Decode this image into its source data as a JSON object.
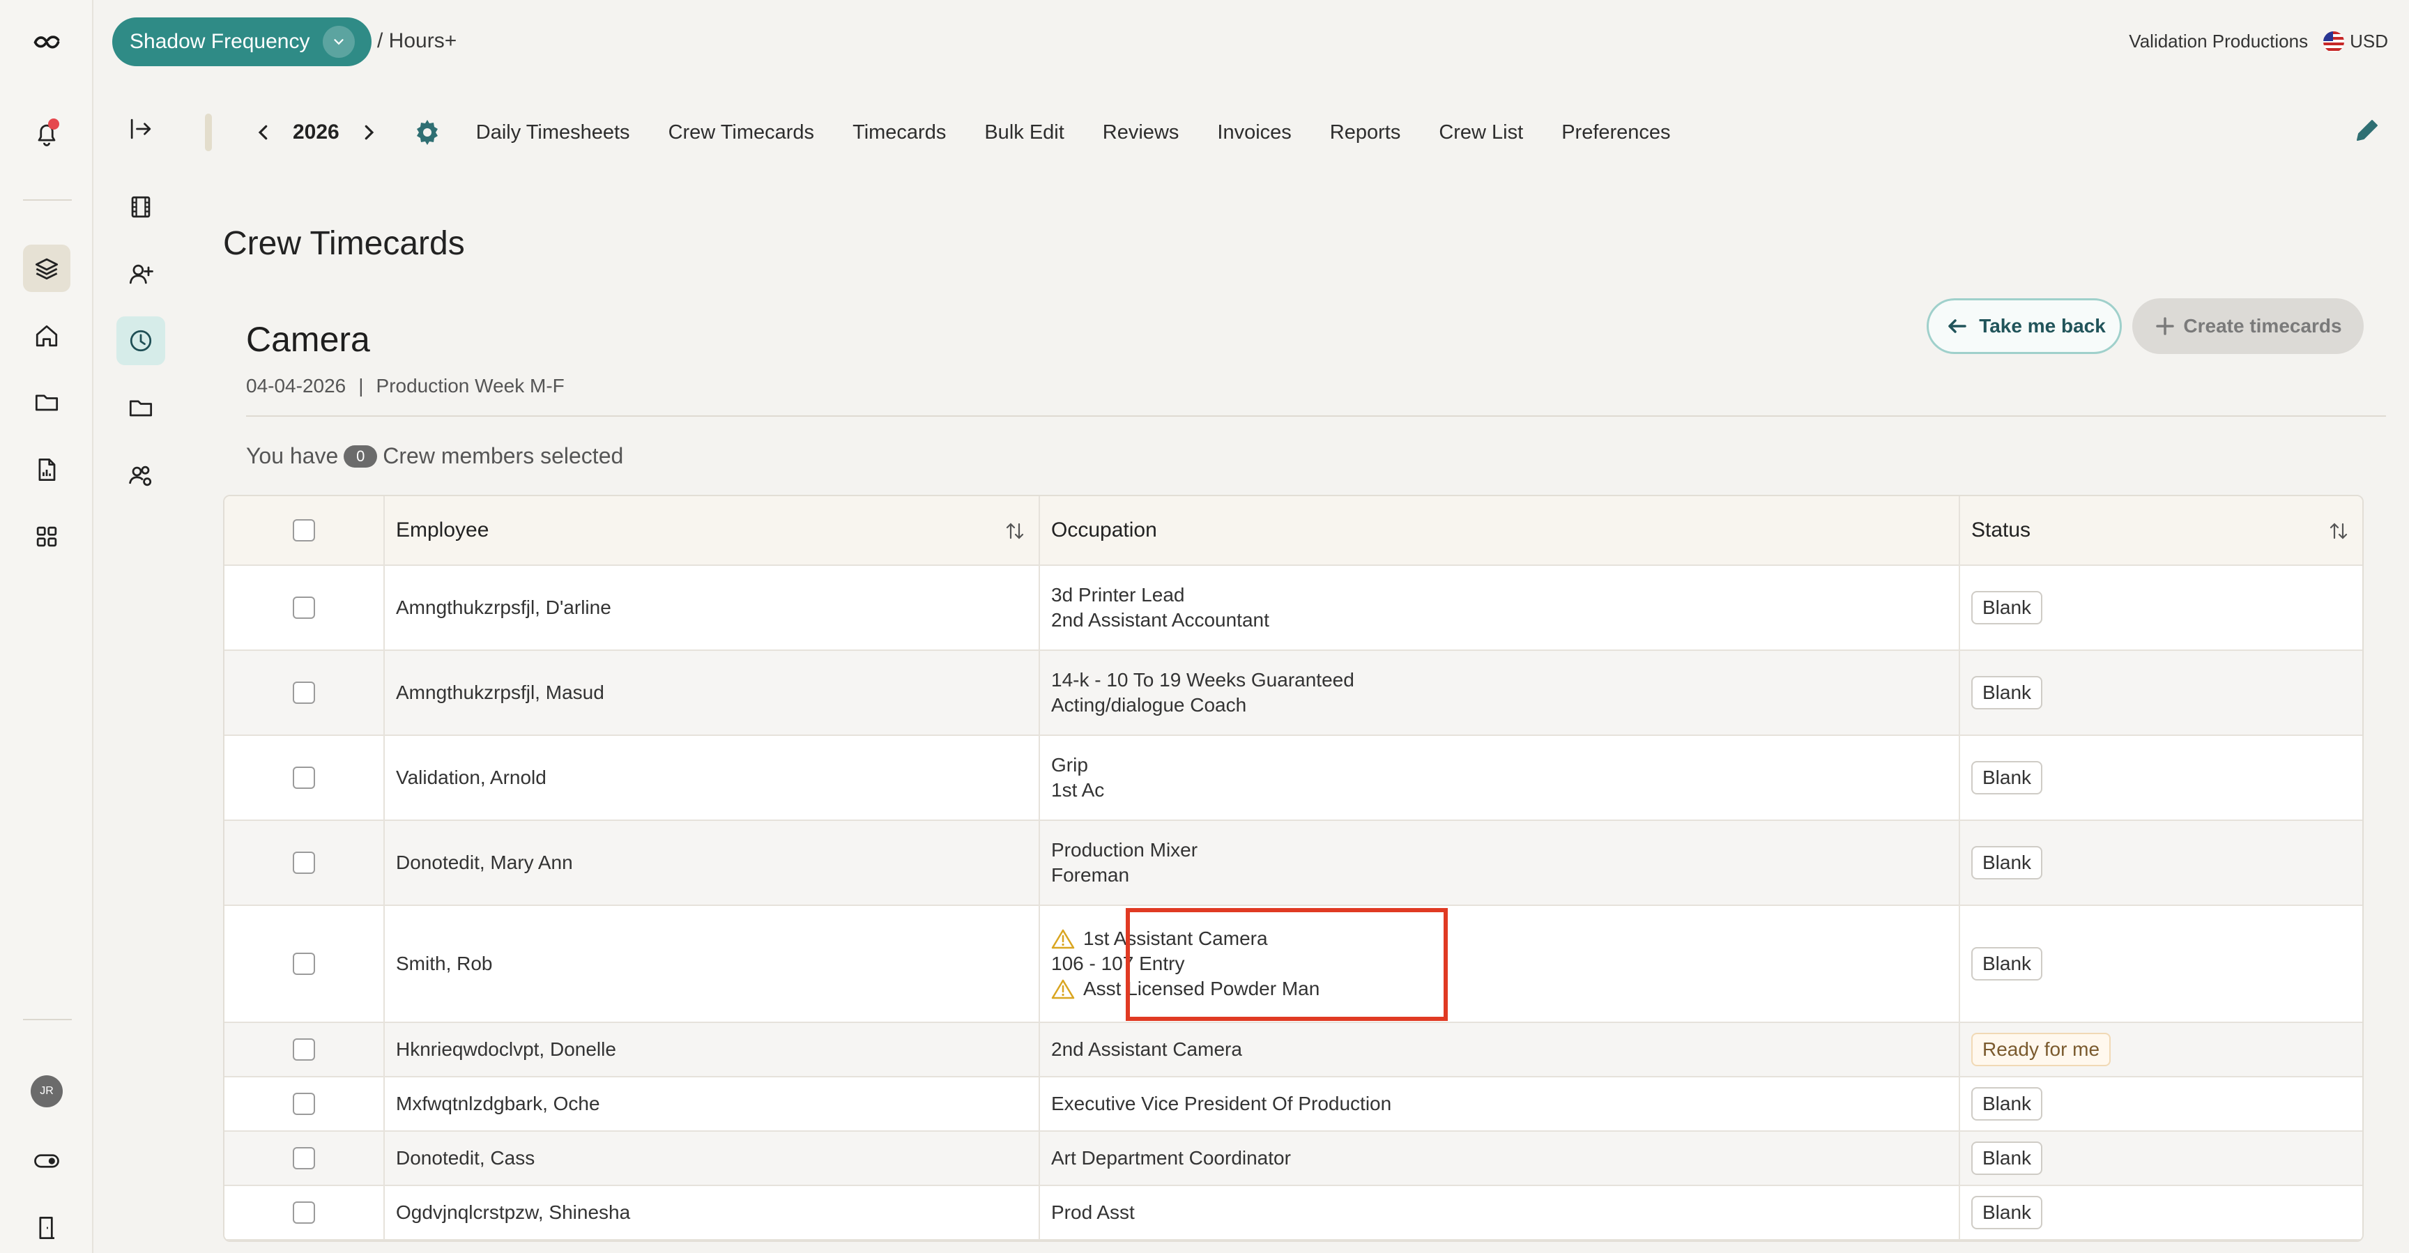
{
  "topbar": {
    "project_name": "Shadow Frequency",
    "breadcrumb": "/ Hours+",
    "company": "Validation Productions",
    "currency": "USD"
  },
  "nav": {
    "year": "2026",
    "items": [
      "Daily Timesheets",
      "Crew Timecards",
      "Timecards",
      "Bulk Edit",
      "Reviews",
      "Invoices",
      "Reports",
      "Crew List",
      "Preferences"
    ]
  },
  "user": {
    "initials": "JR"
  },
  "page": {
    "title": "Crew Timecards",
    "section": "Camera",
    "date": "04-04-2026",
    "week": "Production Week M-F",
    "back_label": "Take me back",
    "create_label": "Create timecards",
    "selected_prefix": "You have",
    "selected_count": "0",
    "selected_suffix": "Crew members selected"
  },
  "table": {
    "headers": {
      "employee": "Employee",
      "occupation": "Occupation",
      "status": "Status"
    },
    "rows": [
      {
        "employee": "Amngthukzrpsfjl, D'arline",
        "occupations": [
          "3d Printer Lead",
          "2nd Assistant Accountant"
        ],
        "status": "Blank"
      },
      {
        "employee": "Amngthukzrpsfjl, Masud",
        "occupations": [
          "14-k - 10 To 19 Weeks Guaranteed",
          "Acting/dialogue Coach"
        ],
        "status": "Blank"
      },
      {
        "employee": "Validation, Arnold",
        "occupations": [
          "Grip",
          "1st Ac"
        ],
        "status": "Blank"
      },
      {
        "employee": "Donotedit, Mary Ann",
        "occupations": [
          "Production Mixer",
          "Foreman"
        ],
        "status": "Blank"
      },
      {
        "employee": "Smith, Rob",
        "occupations": [
          "1st Assistant Camera",
          "106 - 107 Entry",
          "Asst Licensed Powder Man"
        ],
        "status": "Blank"
      },
      {
        "employee": "Hknrieqwdoclvpt, Donelle",
        "occupations": [
          "2nd Assistant Camera"
        ],
        "status": "Ready for me"
      },
      {
        "employee": "Mxfwqtnlzdgbark, Oche",
        "occupations": [
          "Executive Vice President Of Production"
        ],
        "status": "Blank"
      },
      {
        "employee": "Donotedit, Cass",
        "occupations": [
          "Art Department Coordinator"
        ],
        "status": "Blank"
      },
      {
        "employee": "Ogdvjnqlcrstpzw, Shinesha",
        "occupations": [
          "Prod Asst"
        ],
        "status": "Blank"
      }
    ]
  }
}
